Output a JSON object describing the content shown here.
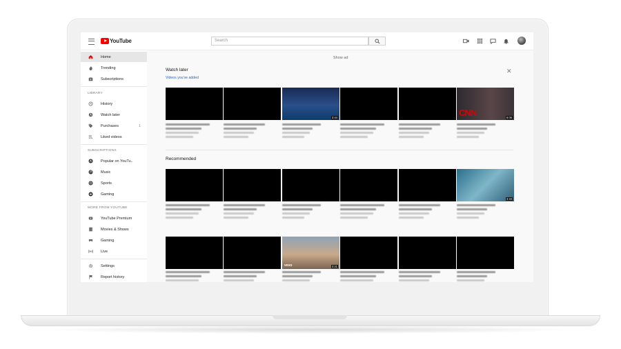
{
  "app": {
    "logo_text": "YouTube",
    "search_placeholder": "Search"
  },
  "sidebar": {
    "main": [
      {
        "label": "Home",
        "icon": "home-icon",
        "active": true
      },
      {
        "label": "Trending",
        "icon": "flame-icon"
      },
      {
        "label": "Subscriptions",
        "icon": "subscriptions-icon"
      }
    ],
    "library_header": "LIBRARY",
    "library": [
      {
        "label": "History",
        "icon": "history-icon"
      },
      {
        "label": "Watch later",
        "icon": "clock-icon"
      },
      {
        "label": "Purchases",
        "icon": "tag-icon",
        "count": "1"
      },
      {
        "label": "Liked videos",
        "icon": "playlist-icon"
      }
    ],
    "subscriptions_header": "SUBSCRIPTIONS",
    "subscriptions": [
      {
        "label": "Popular on YouTu..",
        "icon": "popular-icon"
      },
      {
        "label": "Music",
        "icon": "music-icon"
      },
      {
        "label": "Sports",
        "icon": "sports-icon"
      },
      {
        "label": "Gaming",
        "icon": "gaming-channel-icon"
      }
    ],
    "more_header": "MORE FROM YOUTUBE",
    "more": [
      {
        "label": "YouTube Premium",
        "icon": "youtube-premium-icon"
      },
      {
        "label": "Movies & Shows",
        "icon": "film-icon"
      },
      {
        "label": "Gaming",
        "icon": "gamepad-icon"
      },
      {
        "label": "Live",
        "icon": "live-icon"
      }
    ],
    "footer": [
      {
        "label": "Settings",
        "icon": "gear-icon"
      },
      {
        "label": "Report history",
        "icon": "flag-icon"
      }
    ]
  },
  "main": {
    "show_ad": "Show ad",
    "watch_later": {
      "title": "Watch later",
      "subtitle": "Videos you've added",
      "durations": [
        "",
        "",
        "3:44",
        "",
        "",
        "6:06"
      ]
    },
    "recommended": {
      "title": "Recommended",
      "row1_durations": [
        "",
        "",
        "",
        "",
        "",
        "3:33"
      ],
      "row2_durations": [
        "",
        "",
        "3:21",
        "",
        "",
        ""
      ]
    }
  },
  "colors": {
    "brand_red": "#ff0000",
    "active_bg": "#e6e6e6",
    "link_blue": "#1a65c9"
  }
}
